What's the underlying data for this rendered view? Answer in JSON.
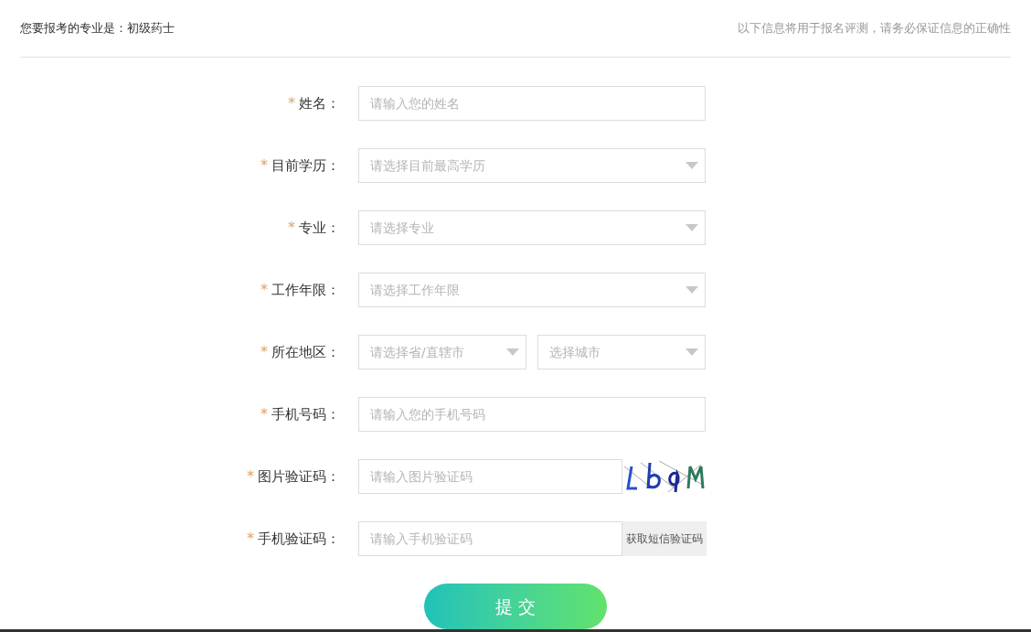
{
  "header": {
    "major_label": "您要报考的专业是：初级药士",
    "notice": "以下信息将用于报名评测，请务必保证信息的正确性"
  },
  "fields": [
    {
      "kind": "text",
      "required_mark": "*",
      "label": "姓名：",
      "placeholder": "请输入您的姓名"
    },
    {
      "kind": "select",
      "required_mark": "*",
      "label": "目前学历：",
      "placeholder": "请选择目前最高学历"
    },
    {
      "kind": "select",
      "required_mark": "*",
      "label": "专业：",
      "placeholder": "请选择专业"
    },
    {
      "kind": "select",
      "required_mark": "*",
      "label": "工作年限：",
      "placeholder": "请选择工作年限"
    },
    {
      "kind": "region",
      "required_mark": "*",
      "label": "所在地区：",
      "placeholders": [
        "请选择省/直辖市",
        "选择城市"
      ]
    },
    {
      "kind": "text",
      "required_mark": "*",
      "label": "手机号码：",
      "placeholder": "请输入您的手机号码"
    },
    {
      "kind": "captcha",
      "required_mark": "*",
      "label": "图片验证码：",
      "placeholder": "请输入图片验证码"
    },
    {
      "kind": "sms",
      "required_mark": "*",
      "label": "手机验证码：",
      "placeholder": "请输入手机验证码",
      "button": "获取短信验证码"
    }
  ],
  "submit": "提 交"
}
